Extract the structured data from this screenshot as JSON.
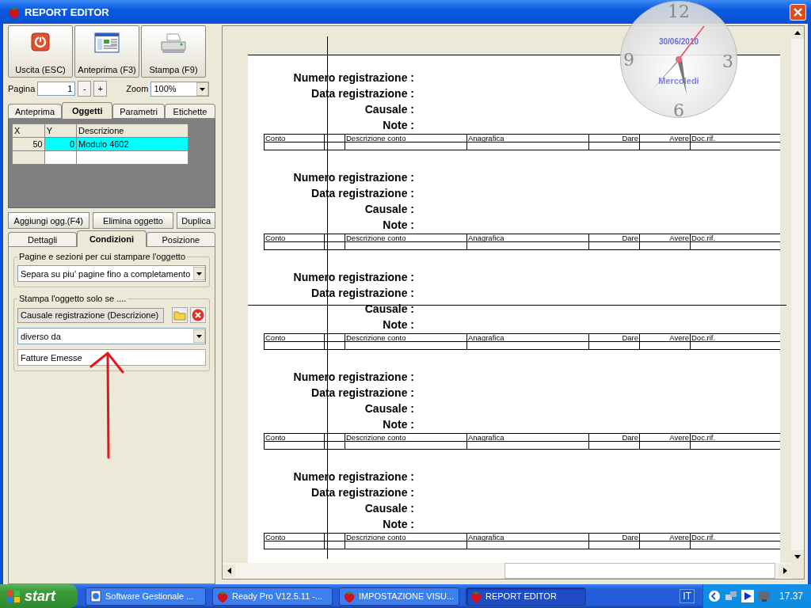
{
  "window": {
    "title": "REPORT EDITOR"
  },
  "toolbar": [
    {
      "kind": "exit",
      "label": "Uscita (ESC)"
    },
    {
      "kind": "preview",
      "label": "Anteprima (F3)"
    },
    {
      "kind": "print",
      "label": "Stampa (F9)"
    }
  ],
  "pager": {
    "page_label": "Pagina",
    "page_value": "1",
    "minus": "-",
    "plus": "+",
    "zoom_label": "Zoom",
    "zoom_value": "100%"
  },
  "tabs": [
    {
      "label": "Anteprima",
      "selected": false
    },
    {
      "label": "Oggetti",
      "selected": true
    },
    {
      "label": "Parametri",
      "selected": false
    },
    {
      "label": "Etichette",
      "selected": false
    }
  ],
  "objects_grid": {
    "columns": [
      "X",
      "Y",
      "Descrizione"
    ],
    "rows": [
      {
        "cells": [
          "50",
          "0",
          "Modulo 4602"
        ],
        "selected": true
      }
    ]
  },
  "object_buttons": [
    "Aggiungi ogg.(F4)",
    "Elimina oggetto",
    "Duplica"
  ],
  "subtabs": [
    {
      "label": "Dettagli",
      "selected": false
    },
    {
      "label": "Condizioni",
      "selected": true
    },
    {
      "label": "Posizione",
      "selected": false
    }
  ],
  "pages_group": {
    "title": "Pagine e sezioni per cui stampare l'oggetto",
    "value": "Separa su piu' pagine fino a completamento"
  },
  "condition_group": {
    "title": "Stampa l'oggetto solo se ....",
    "field": "Causale registrazione (Descrizione)",
    "operator": "diverso da",
    "value": "Fatture Emesse"
  },
  "report": {
    "sections": [
      {
        "labels": [
          "Numero registrazione :",
          "Data registrazione :",
          "Causale :",
          "Note :"
        ],
        "columns": [
          {
            "text": "Conto",
            "numeric": false
          },
          {
            "text": "Descrizione conto",
            "numeric": false
          },
          {
            "text": "Anagrafica",
            "numeric": false
          },
          {
            "text": "Dare",
            "numeric": true
          },
          {
            "text": "Avere",
            "numeric": true
          },
          {
            "text": "Doc.rif.",
            "numeric": false
          }
        ]
      },
      {
        "labels": [
          "Numero registrazione :",
          "Data registrazione :",
          "Causale :",
          "Note :"
        ],
        "columns": [
          {
            "text": "Conto",
            "numeric": false
          },
          {
            "text": "Descrizione conto",
            "numeric": false
          },
          {
            "text": "Anagrafica",
            "numeric": false
          },
          {
            "text": "Dare",
            "numeric": true
          },
          {
            "text": "Avere",
            "numeric": true
          },
          {
            "text": "Doc.rif.",
            "numeric": false
          }
        ]
      },
      {
        "labels": [
          "Numero registrazione :",
          "Data registrazione :",
          "Causale :",
          "Note :"
        ],
        "columns": [
          {
            "text": "Conto",
            "numeric": false
          },
          {
            "text": "Descrizione conto",
            "numeric": false
          },
          {
            "text": "Anagrafica",
            "numeric": false
          },
          {
            "text": "Dare",
            "numeric": true
          },
          {
            "text": "Avere",
            "numeric": true
          },
          {
            "text": "Doc.rif.",
            "numeric": false
          }
        ]
      },
      {
        "labels": [
          "Numero registrazione :",
          "Data registrazione :",
          "Causale :",
          "Note :"
        ],
        "columns": [
          {
            "text": "Conto",
            "numeric": false
          },
          {
            "text": "Descrizione conto",
            "numeric": false
          },
          {
            "text": "Anagrafica",
            "numeric": false
          },
          {
            "text": "Dare",
            "numeric": true
          },
          {
            "text": "Avere",
            "numeric": true
          },
          {
            "text": "Doc.rif.",
            "numeric": false
          }
        ]
      },
      {
        "labels": [
          "Numero registrazione :",
          "Data registrazione :",
          "Causale :",
          "Note :"
        ],
        "columns": [
          {
            "text": "Conto",
            "numeric": false
          },
          {
            "text": "Descrizione conto",
            "numeric": false
          },
          {
            "text": "Anagrafica",
            "numeric": false
          },
          {
            "text": "Dare",
            "numeric": true
          },
          {
            "text": "Avere",
            "numeric": true
          },
          {
            "text": "Doc.rif.",
            "numeric": false
          }
        ]
      }
    ]
  },
  "clock": {
    "numerals": [
      "12",
      "3",
      "6",
      "9"
    ],
    "date": "30/06/2010",
    "day": "Mercoledi"
  },
  "taskbar": {
    "start": "start",
    "tasks": [
      {
        "label": "Software Gestionale ...",
        "kind": "browser",
        "selected": false
      },
      {
        "label": "Ready Pro V12.5.11 -...",
        "kind": "app",
        "selected": false
      },
      {
        "label": "IMPOSTAZIONE VISU...",
        "kind": "app",
        "selected": false
      },
      {
        "label": "REPORT EDITOR",
        "kind": "app",
        "selected": true
      }
    ],
    "language": "IT",
    "time": "17.37"
  }
}
